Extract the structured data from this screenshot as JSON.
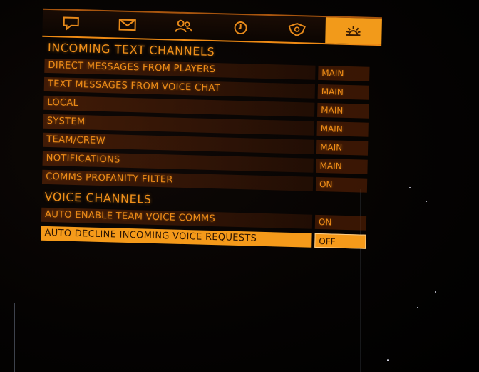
{
  "tabs": [
    {
      "icon": "speech-bubble-icon",
      "active": false
    },
    {
      "icon": "envelope-icon",
      "active": false
    },
    {
      "icon": "contacts-icon",
      "active": false
    },
    {
      "icon": "clock-icon",
      "active": false
    },
    {
      "icon": "squadron-icon",
      "active": false
    },
    {
      "icon": "settings-cog-icon",
      "active": true
    }
  ],
  "sections": {
    "incoming_text": "INCOMING TEXT CHANNELS",
    "voice": "VOICE CHANNELS"
  },
  "text_rows": [
    {
      "label": "DIRECT MESSAGES FROM PLAYERS",
      "value": "MAIN"
    },
    {
      "label": "TEXT MESSAGES FROM VOICE CHAT",
      "value": "MAIN"
    },
    {
      "label": "LOCAL",
      "value": "MAIN"
    },
    {
      "label": "SYSTEM",
      "value": "MAIN"
    },
    {
      "label": "TEAM/CREW",
      "value": "MAIN"
    },
    {
      "label": "NOTIFICATIONS",
      "value": "MAIN"
    },
    {
      "label": "COMMS PROFANITY FILTER",
      "value": "ON"
    }
  ],
  "voice_rows": [
    {
      "label": "AUTO ENABLE TEAM VOICE COMMS",
      "value": "ON"
    },
    {
      "label": "AUTO DECLINE INCOMING VOICE REQUESTS",
      "value": "OFF"
    }
  ],
  "colors": {
    "accent": "#f29a1a",
    "text": "#ee8c18",
    "row_bg": "#6e2c08",
    "background": "#050302"
  }
}
